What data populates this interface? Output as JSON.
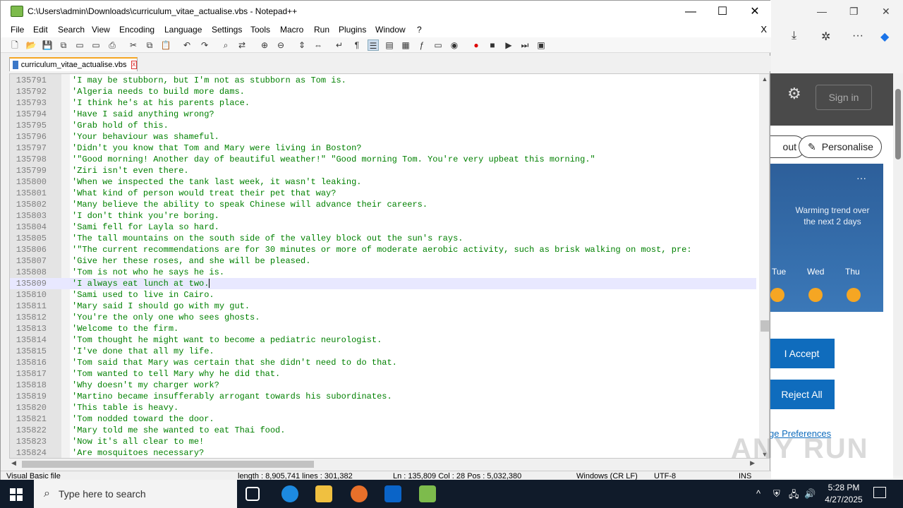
{
  "window": {
    "title": "C:\\Users\\admin\\Downloads\\curriculum_vitae_actualise.vbs - Notepad++",
    "minimize": "—",
    "maximize": "☐",
    "close": "✕"
  },
  "menu": {
    "items": [
      "File",
      "Edit",
      "Search",
      "View",
      "Encoding",
      "Language",
      "Settings",
      "Tools",
      "Macro",
      "Run",
      "Plugins",
      "Window",
      "?"
    ],
    "close_doc": "X"
  },
  "tab": {
    "label": "curriculum_vitae_actualise.vbs",
    "close": "x"
  },
  "editor": {
    "lines": [
      {
        "num": "135791",
        "text": "'I may be stubborn, but I'm not as stubborn as Tom is."
      },
      {
        "num": "135792",
        "text": "'Algeria needs to build more dams."
      },
      {
        "num": "135793",
        "text": "'I think he's at his parents place."
      },
      {
        "num": "135794",
        "text": "'Have I said anything wrong?"
      },
      {
        "num": "135795",
        "text": "'Grab hold of this."
      },
      {
        "num": "135796",
        "text": "'Your behaviour was shameful."
      },
      {
        "num": "135797",
        "text": "'Didn't you know that Tom and Mary were living in Boston?"
      },
      {
        "num": "135798",
        "text": "'\"Good morning! Another day of beautiful weather!\" \"Good morning Tom. You're very upbeat this morning.\""
      },
      {
        "num": "135799",
        "text": "'Ziri isn't even there."
      },
      {
        "num": "135800",
        "text": "'When we inspected the tank last week, it wasn't leaking."
      },
      {
        "num": "135801",
        "text": "'What kind of person would treat their pet that way?"
      },
      {
        "num": "135802",
        "text": "'Many believe the ability to speak Chinese will advance their careers."
      },
      {
        "num": "135803",
        "text": "'I don't think you're boring."
      },
      {
        "num": "135804",
        "text": "'Sami fell for Layla so hard."
      },
      {
        "num": "135805",
        "text": "'The tall mountains on the south side of the valley block out the sun's rays."
      },
      {
        "num": "135806",
        "text": "'\"The current recommendations are for 30 minutes or more of moderate aerobic activity, such as brisk walking on most, pre:"
      },
      {
        "num": "135807",
        "text": "'Give her these roses, and she will be pleased."
      },
      {
        "num": "135808",
        "text": "'Tom is not who he says he is."
      },
      {
        "num": "135809",
        "text": "'I always eat lunch at two."
      },
      {
        "num": "135810",
        "text": "'Sami used to live in Cairo."
      },
      {
        "num": "135811",
        "text": "'Mary said I should go with my gut."
      },
      {
        "num": "135812",
        "text": "'You're the only one who sees ghosts."
      },
      {
        "num": "135813",
        "text": "'Welcome to the firm."
      },
      {
        "num": "135814",
        "text": "'Tom thought he might want to become a pediatric neurologist."
      },
      {
        "num": "135815",
        "text": "'I've done that all my life."
      },
      {
        "num": "135816",
        "text": "'Tom said that Mary was certain that she didn't need to do that."
      },
      {
        "num": "135817",
        "text": "'Tom wanted to tell Mary why he did that."
      },
      {
        "num": "135818",
        "text": "'Why doesn't my charger work?"
      },
      {
        "num": "135819",
        "text": "'Martino became insufferably arrogant towards his subordinates."
      },
      {
        "num": "135820",
        "text": "'This table is heavy."
      },
      {
        "num": "135821",
        "text": "'Tom nodded toward the door."
      },
      {
        "num": "135822",
        "text": "'Mary told me she wanted to eat Thai food."
      },
      {
        "num": "135823",
        "text": "'Now it's all clear to me!"
      },
      {
        "num": "135824",
        "text": "'Are mosquitoes necessary?"
      }
    ],
    "current_line": "135809"
  },
  "status": {
    "file_type": "Visual Basic file",
    "length": "length : 8,905,741    lines : 301,382",
    "position": "Ln : 135,809    Col : 28    Pos : 5,032,380",
    "eol": "Windows (CR LF)",
    "encoding": "UTF-8",
    "mode": "INS"
  },
  "browser": {
    "sign_in": "Sign in",
    "pill_left": "out",
    "pill_right": "Personalise",
    "weather_dots": "···",
    "warming_trend": "Warming trend over the next 2 days",
    "days": [
      "Tue",
      "Wed",
      "Thu"
    ],
    "accept": "I Accept",
    "reject": "Reject All",
    "prefs": "ge Preferences"
  },
  "taskbar": {
    "search_placeholder": "Type here to search",
    "time": "5:28 PM",
    "date": "4/27/2025"
  },
  "watermark": "ANY RUN"
}
